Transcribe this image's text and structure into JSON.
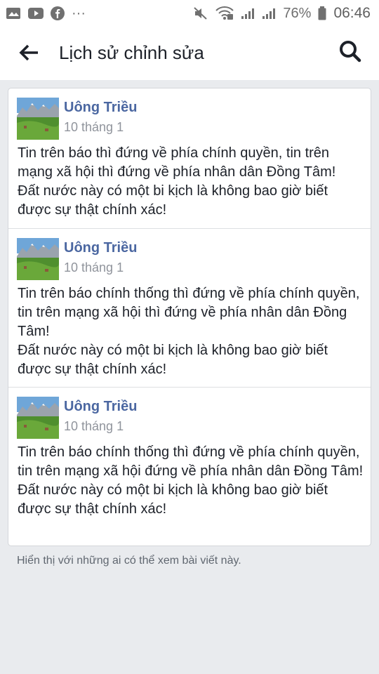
{
  "status_bar": {
    "battery": "76%",
    "time": "06:46",
    "dots": "···",
    "icons": [
      "gallery-icon",
      "youtube-icon",
      "facebook-icon",
      "mute-icon",
      "wifi-icon",
      "signal-icon",
      "signal-icon",
      "battery-icon"
    ]
  },
  "header": {
    "title": "Lịch sử chỉnh sửa",
    "back_icon": "arrow-left-icon",
    "search_icon": "search-icon"
  },
  "entries": [
    {
      "author": "Uông Triều",
      "date": "10 tháng 1",
      "text": "Tin trên báo thì đứng về phía chính quyền, tin trên mạng xã hội thì đứng về phía nhân dân Đồng Tâm!\nĐất nước này có một bi kịch là không bao giờ biết được sự thật chính xác!"
    },
    {
      "author": "Uông Triều",
      "date": "10 tháng 1",
      "text": "Tin trên báo chính thống thì đứng về phía chính quyền, tin trên mạng xã hội thì đứng về phía nhân dân Đồng Tâm!\nĐất nước này có một bi kịch là không bao giờ biết được sự thật chính xác!"
    },
    {
      "author": "Uông Triều",
      "date": "10 tháng 1",
      "text": "Tin trên báo chính thống thì đứng về phía chính quyền, tin trên mạng xã hội đứng về phía nhân dân Đồng Tâm!\nĐất nước này có một bi kịch là không bao giờ biết được sự thật chính xác!"
    }
  ],
  "footer": {
    "note": "Hiển thị với những ai có thể xem bài viết này."
  },
  "colors": {
    "author": "#4b67a1",
    "background": "#e9ebee",
    "text": "#1d2129"
  }
}
